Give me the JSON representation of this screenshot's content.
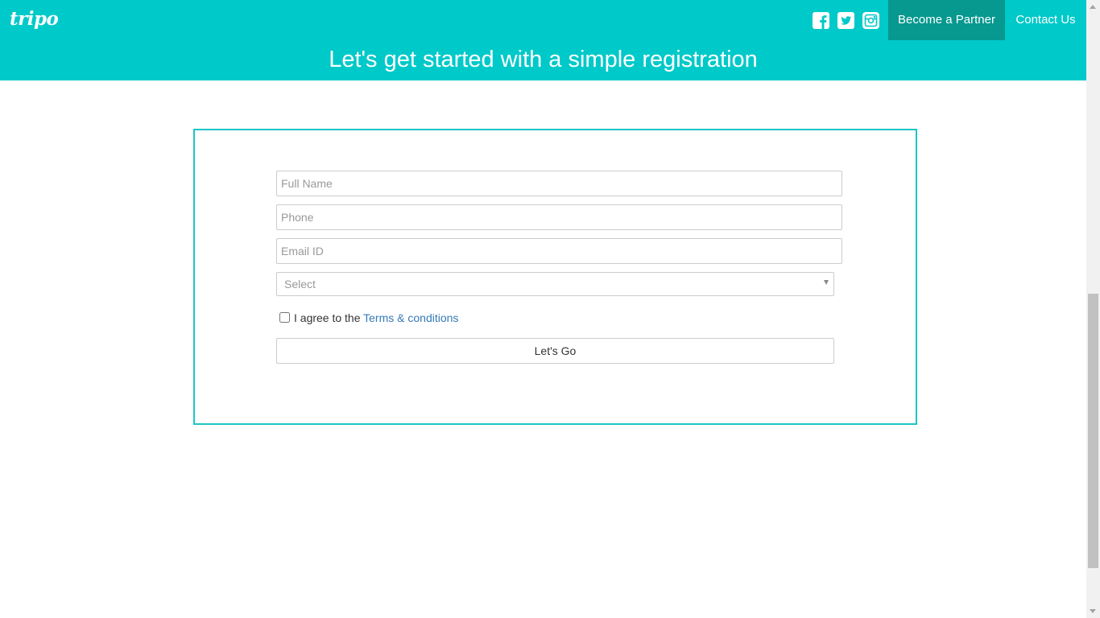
{
  "header": {
    "logo_text": "tripo",
    "brand_color": "#00c9c9",
    "title": "Let's get started with a simple registration",
    "social_icons": [
      "facebook-icon",
      "twitter-icon",
      "instagram-icon"
    ],
    "nav": {
      "partner_label": "Become a Partner",
      "contact_label": "Contact Us"
    }
  },
  "form": {
    "full_name_placeholder": "Full Name",
    "phone_placeholder": "Phone",
    "email_placeholder": "Email ID",
    "select_value": "Select",
    "agree_text": "I agree to the",
    "terms_label": "Terms & conditions",
    "submit_label": "Let's Go"
  }
}
